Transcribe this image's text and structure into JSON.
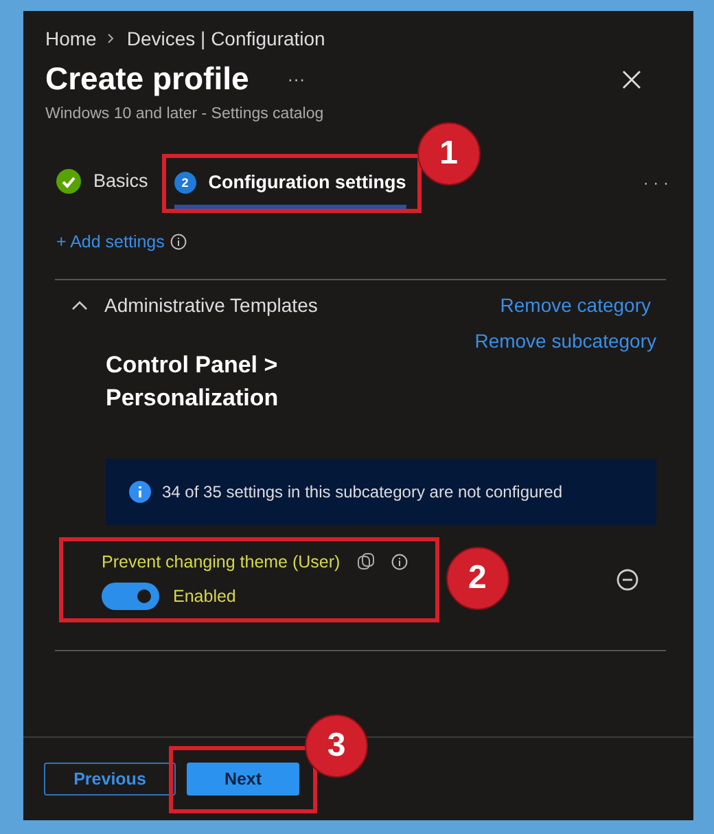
{
  "breadcrumb": [
    "Home",
    "Devices | Configuration"
  ],
  "title": "Create profile",
  "title_menu": "···",
  "subtitle": "Windows 10 and later - Settings catalog",
  "tabs": [
    {
      "label": "Basics",
      "kind": "check",
      "selected": false
    },
    {
      "label": "Configuration settings",
      "kind": "number",
      "step": "2",
      "selected": true,
      "callout": "1"
    }
  ],
  "tabs_menu": "· · ·",
  "add_settings": "+ Add settings",
  "category": {
    "name": "Administrative Templates",
    "expanded": true,
    "remove": "Remove category"
  },
  "subcategory": {
    "name": "Control Panel > Personalization",
    "remove": "Remove subcategory"
  },
  "info": "34 of 35 settings in this subcategory are not configured",
  "setting": {
    "name": "Prevent changing theme (User)",
    "on": true,
    "state": "Enabled",
    "callout": "2"
  },
  "buttons": [
    {
      "label": "Previous",
      "kind": "secondary"
    },
    {
      "label": "Next",
      "kind": "primary",
      "callout": "3"
    }
  ]
}
